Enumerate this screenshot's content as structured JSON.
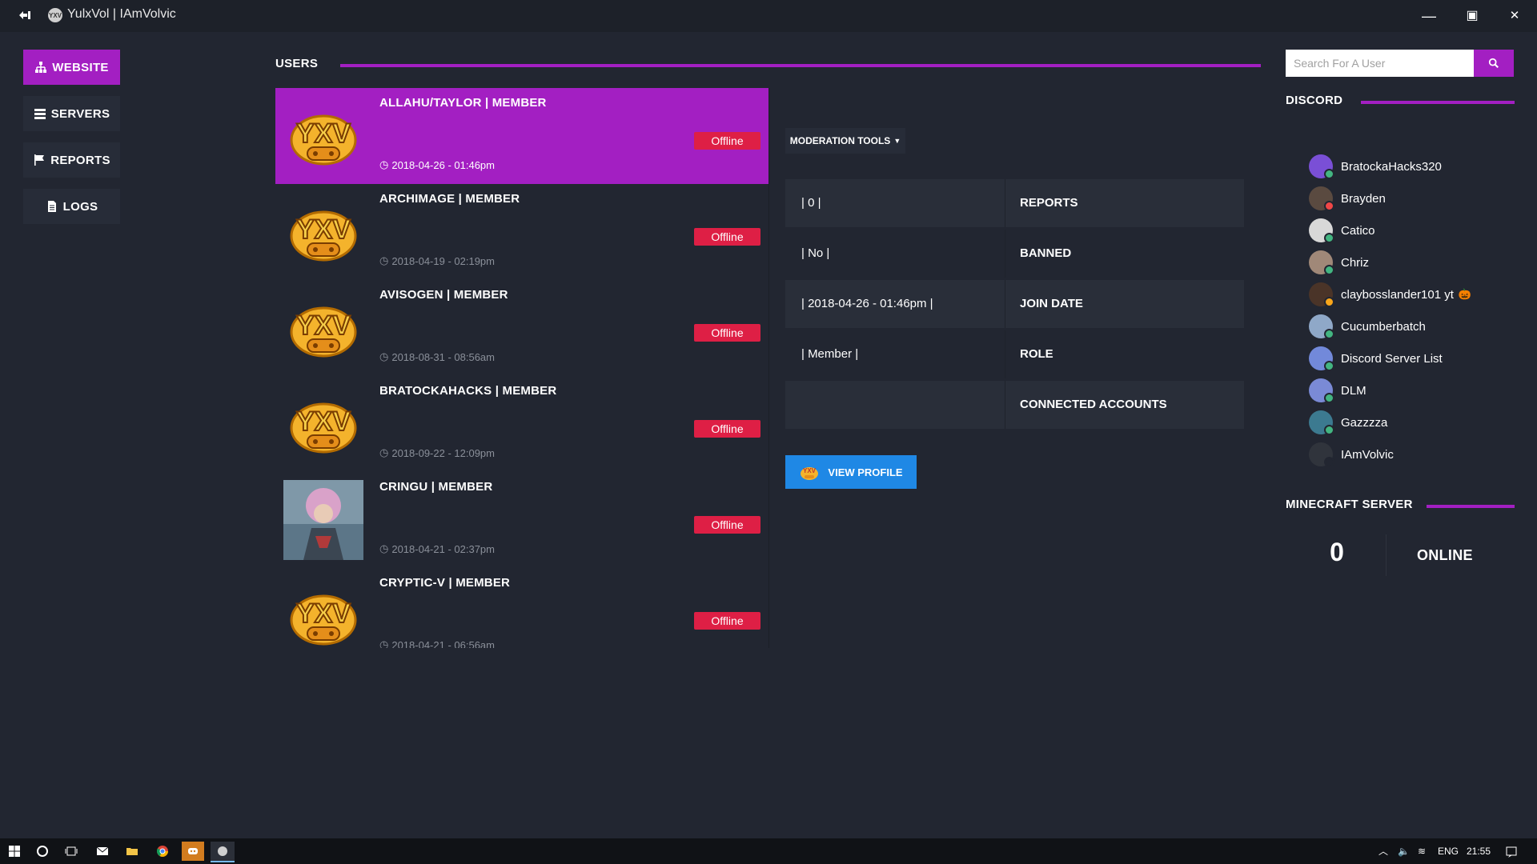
{
  "window": {
    "title": "YulxVol | IAmVolvic",
    "minimize_glyph": "—",
    "maximize_glyph": "▣",
    "close_glyph": "✕"
  },
  "nav": {
    "items": [
      {
        "label": "WEBSITE",
        "icon": "sitemap-icon",
        "active": true
      },
      {
        "label": "SERVERS",
        "icon": "server-icon",
        "active": false
      },
      {
        "label": "REPORTS",
        "icon": "flag-icon",
        "active": false
      },
      {
        "label": "LOGS",
        "icon": "file-icon",
        "active": false
      }
    ]
  },
  "users": {
    "title": "USERS",
    "list": [
      {
        "name": "ALLAHU/TAYLOR | MEMBER",
        "date": "2018-04-26 - 01:46pm",
        "status": "Offline",
        "avatar": "yxv-logo",
        "selected": true
      },
      {
        "name": "ARCHIMAGE | MEMBER",
        "date": "2018-04-19 - 02:19pm",
        "status": "Offline",
        "avatar": "yxv-logo",
        "selected": false
      },
      {
        "name": "AVISOGEN | MEMBER",
        "date": "2018-08-31 - 08:56am",
        "status": "Offline",
        "avatar": "yxv-logo",
        "selected": false
      },
      {
        "name": "BRATOCKAHACKS | MEMBER",
        "date": "2018-09-22 - 12:09pm",
        "status": "Offline",
        "avatar": "yxv-logo",
        "selected": false
      },
      {
        "name": "CRINGU | MEMBER",
        "date": "2018-04-21 - 02:37pm",
        "status": "Offline",
        "avatar": "anime-photo",
        "selected": false
      },
      {
        "name": "CRYPTIC-V | MEMBER",
        "date": "2018-04-21 - 06:56am",
        "status": "Offline",
        "avatar": "yxv-logo",
        "selected": false
      }
    ]
  },
  "moderation": {
    "button_label": "MODERATION TOOLS",
    "details": [
      {
        "value": "| 0 |",
        "key": "REPORTS"
      },
      {
        "value": "| No |",
        "key": "BANNED"
      },
      {
        "value": "| 2018-04-26 - 01:46pm |",
        "key": "JOIN DATE"
      },
      {
        "value": "| Member |",
        "key": "ROLE"
      },
      {
        "value": "",
        "key": "CONNECTED ACCOUNTS"
      }
    ],
    "view_profile_label": "VIEW PROFILE"
  },
  "search": {
    "placeholder": "Search For A User"
  },
  "discord": {
    "title": "DISCORD",
    "members": [
      {
        "name": "BratockaHacks320",
        "status_color": "#43b581",
        "avatar_color": "#7a4fd6"
      },
      {
        "name": "Brayden",
        "status_color": "#f04747",
        "avatar_color": "#5a4a40"
      },
      {
        "name": "Catico",
        "status_color": "#43b581",
        "avatar_color": "#d8d8d8"
      },
      {
        "name": "Chriz",
        "status_color": "#43b581",
        "avatar_color": "#a08878"
      },
      {
        "name": "claybosslander101 yt",
        "suffix": "🎃",
        "status_color": "#faa61a",
        "avatar_color": "#4a3428"
      },
      {
        "name": "Cucumberbatch",
        "status_color": "#43b581",
        "avatar_color": "#8fa8c8"
      },
      {
        "name": "Discord Server List",
        "status_color": "#43b581",
        "avatar_color": "#7289da"
      },
      {
        "name": "DLM",
        "status_color": "#43b581",
        "avatar_color": "#7a8ad6"
      },
      {
        "name": "Gazzzza",
        "status_color": "#43b581",
        "avatar_color": "#3c7a90"
      },
      {
        "name": "IAmVolvic",
        "status_color": "#222631",
        "avatar_color": "#30343c"
      }
    ]
  },
  "minecraft": {
    "title": "MINECRAFT SERVER",
    "count": "0",
    "label": "ONLINE"
  },
  "taskbar": {
    "language": "ENG",
    "time": "21:55"
  },
  "colors": {
    "accent": "#a31fc2",
    "offline": "#de1f45",
    "primary_button": "#1f88e5",
    "background": "#222631"
  }
}
